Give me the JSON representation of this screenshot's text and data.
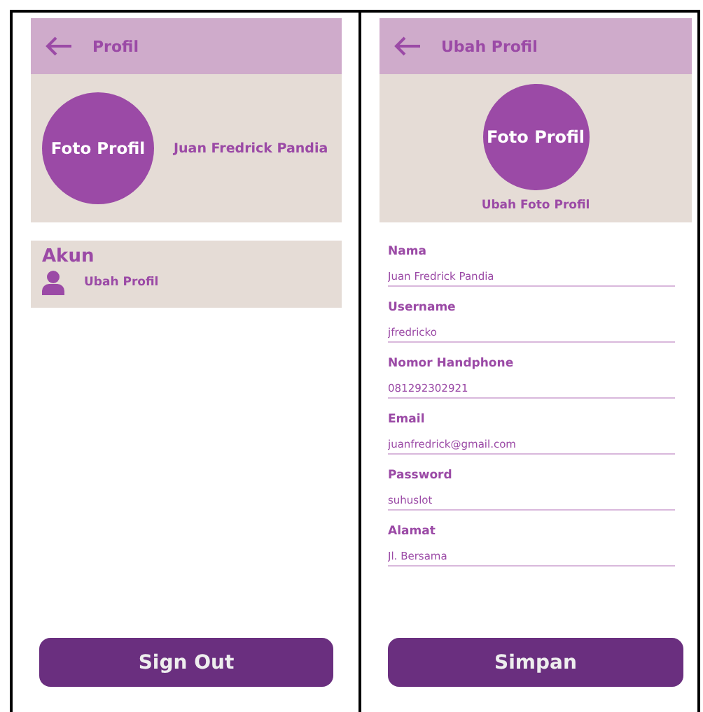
{
  "left_screen": {
    "header": {
      "title": "Profil"
    },
    "profile": {
      "photo_label": "Foto Profil",
      "name": "Juan Fredrick Pandia"
    },
    "account": {
      "heading": "Akun",
      "items": [
        {
          "label": "Ubah Profil"
        }
      ]
    },
    "button": "Sign Out"
  },
  "right_screen": {
    "header": {
      "title": "Ubah Profil"
    },
    "profile": {
      "photo_label": "Foto Profil",
      "change_photo": "Ubah Foto Profil"
    },
    "fields": [
      {
        "label": "Nama",
        "value": "Juan Fredrick Pandia"
      },
      {
        "label": "Username",
        "value": "jfredricko"
      },
      {
        "label": "Nomor Handphone",
        "value": "081292302921"
      },
      {
        "label": "Email",
        "value": "juanfredrick@gmail.com"
      },
      {
        "label": "Password",
        "value": "suhuslot"
      },
      {
        "label": "Alamat",
        "value": "Jl. Bersama"
      }
    ],
    "button": "Simpan"
  }
}
